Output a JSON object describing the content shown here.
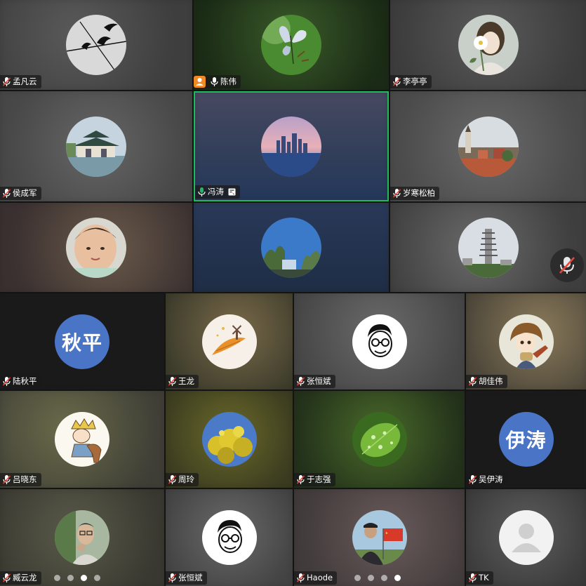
{
  "meeting": {
    "participants": [
      {
        "name": "孟凡云",
        "avatar": "swallows-photo",
        "mic": "muted"
      },
      {
        "name": "陈伟",
        "avatar": "butterfly-photo",
        "mic": "on",
        "role": "host"
      },
      {
        "name": "李亭亭",
        "avatar": "flower-girl-illustration",
        "mic": "muted"
      },
      {
        "name": "侯成军",
        "avatar": "pavilion-photo",
        "mic": "muted"
      },
      {
        "name": "冯涛",
        "avatar": "city-skyline-photo",
        "mic": "active",
        "speaking": true,
        "sharing": true
      },
      {
        "name": "岁寒松柏",
        "avatar": "old-town-photo",
        "mic": "muted"
      },
      {
        "name": "",
        "avatar": "baby-photo"
      },
      {
        "name": "",
        "avatar": "trees-sky-photo"
      },
      {
        "name": "",
        "avatar": "pagoda-photo"
      },
      {
        "name": "陆秋平",
        "avatar": "initials",
        "initials": "秋平",
        "avatar_color": "#4a74c6",
        "mic": "muted"
      },
      {
        "name": "王龙",
        "avatar": "feather-windmill-illustration",
        "mic": "muted"
      },
      {
        "name": "张恒斌",
        "avatar": "glasses-cartoon",
        "mic": "muted"
      },
      {
        "name": "胡佳伟",
        "avatar": "anime-guitar-girl",
        "mic": "muted"
      },
      {
        "name": "吕晓东",
        "avatar": "little-prince-horse",
        "mic": "muted"
      },
      {
        "name": "周玲",
        "avatar": "yellow-blossom-photo",
        "mic": "muted"
      },
      {
        "name": "于志强",
        "avatar": "leaf-droplets-photo",
        "mic": "muted"
      },
      {
        "name": "吴伊涛",
        "avatar": "initials",
        "initials": "伊涛",
        "avatar_color": "#4a74c6",
        "mic": "muted"
      },
      {
        "name": "臧云龙",
        "avatar": "man-portrait-photo",
        "mic": "muted"
      },
      {
        "name": "张恒斌",
        "avatar": "glasses-cartoon",
        "mic": "muted"
      },
      {
        "name": "Haode",
        "avatar": "man-flag-photo",
        "mic": "muted"
      },
      {
        "name": "TK",
        "avatar": "default-person",
        "mic": "muted"
      }
    ]
  },
  "pagination": {
    "pages": 4,
    "active_page": 3
  },
  "controls": {
    "mute_icon": "mic-muted-icon"
  },
  "colors": {
    "speaking_border": "#1fba5a",
    "host_badge": "#f08a24",
    "mic_active": "#1fba5a",
    "mic_muted": "#e5453a"
  }
}
